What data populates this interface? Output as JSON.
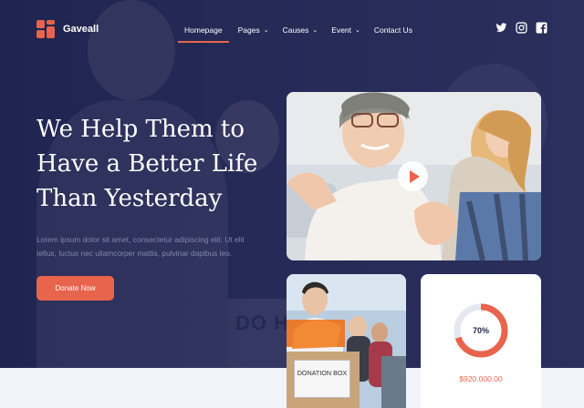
{
  "brand": {
    "name": "Gaveall",
    "accent": "#e8644d",
    "dark": "#1f2450"
  },
  "nav": {
    "items": [
      {
        "label": "Homepage",
        "active": true,
        "dropdown": false
      },
      {
        "label": "Pages",
        "active": false,
        "dropdown": true
      },
      {
        "label": "Causes",
        "active": false,
        "dropdown": true
      },
      {
        "label": "Event",
        "active": false,
        "dropdown": true
      },
      {
        "label": "Contact Us",
        "active": false,
        "dropdown": false
      }
    ]
  },
  "social": [
    "twitter-icon",
    "instagram-icon",
    "facebook-icon"
  ],
  "hero": {
    "headline_lines": [
      "We Help Them to",
      "Have a Better Life",
      "Than Yesterday"
    ],
    "description": "Lorem ipsum dolor sit amet, consectetur adipiscing elit. Ut elit tellus, luctus nec ullamcorper mattis, pulvinar dapibus leo.",
    "cta_label": "Donate Now",
    "bg_box_text": "DO H"
  },
  "video": {
    "play_icon": "play-icon"
  },
  "photo": {
    "box_label": "DONATION BOX"
  },
  "stats": {
    "progress_percent": 70,
    "progress_label": "70%",
    "amount": "$920.000.00"
  }
}
